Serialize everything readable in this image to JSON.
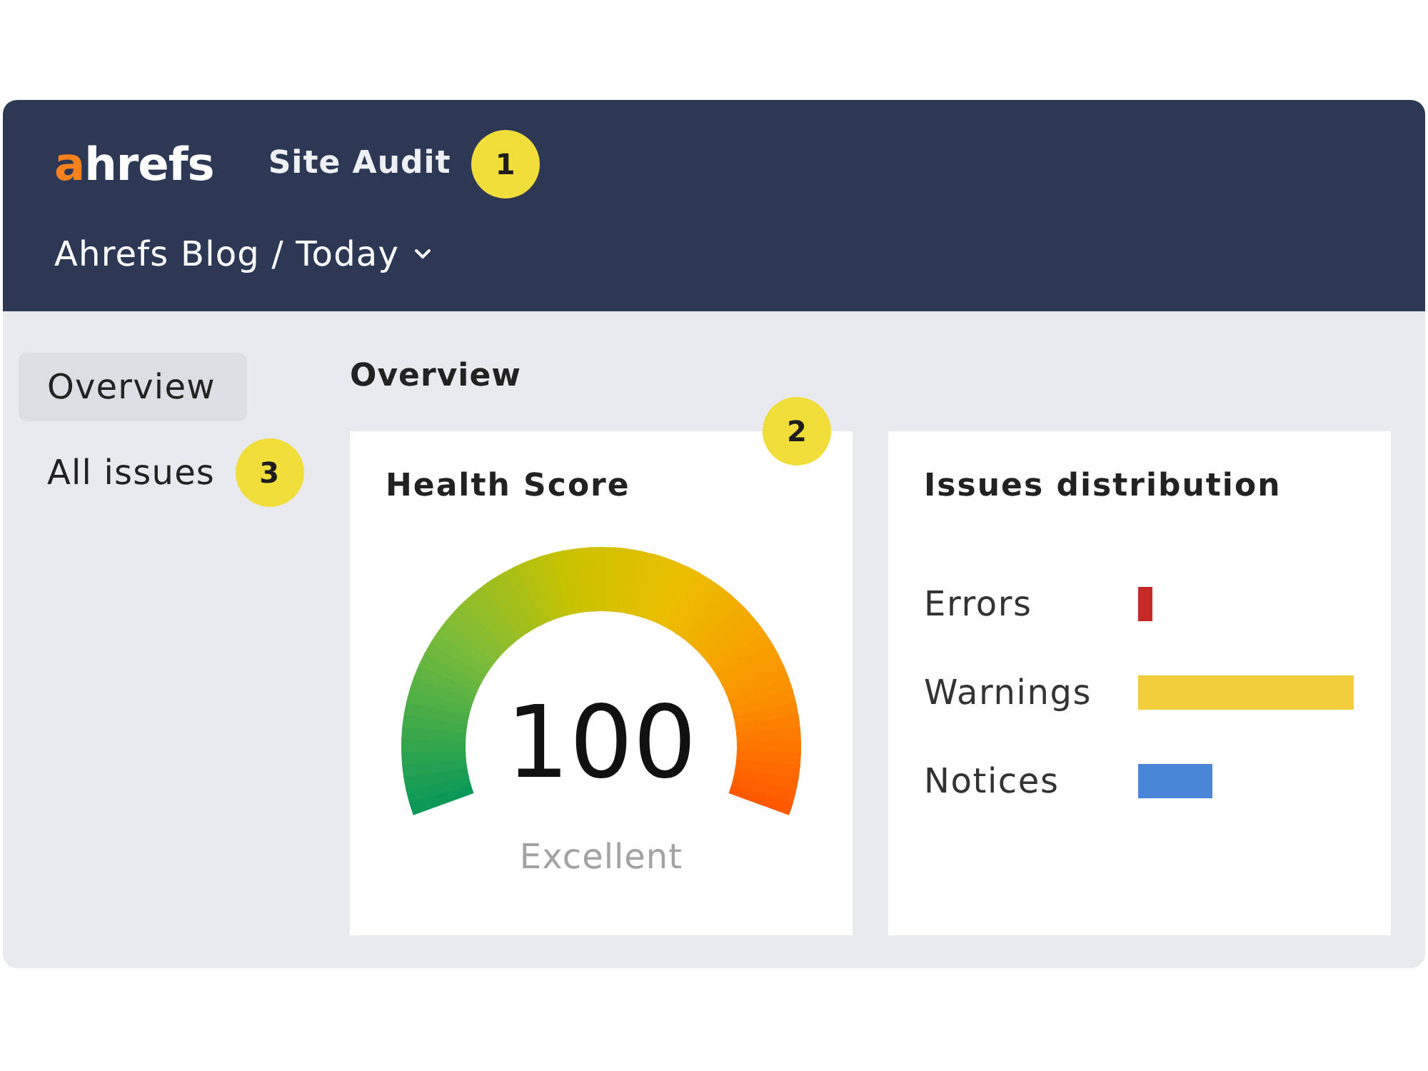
{
  "header": {
    "logo": {
      "accent": "a",
      "rest": "hrefs"
    },
    "product": "Site Audit",
    "product_marker": "1",
    "project_selector": {
      "label": "Ahrefs Blog / Today"
    }
  },
  "sidebar": {
    "items": [
      {
        "label": "Overview",
        "selected": true
      },
      {
        "label": "All issues",
        "selected": false,
        "marker": "3"
      }
    ]
  },
  "main": {
    "title": "Overview",
    "marker": "2",
    "health_score": {
      "title": "Health Score",
      "score": "100",
      "rating": "Excellent"
    },
    "issues_distribution": {
      "title": "Issues distribution",
      "rows": [
        {
          "label": "Errors",
          "color": "#c62828"
        },
        {
          "label": "Warnings",
          "color": "#f2cd3c"
        },
        {
          "label": "Notices",
          "color": "#4a86d8"
        }
      ]
    }
  }
}
